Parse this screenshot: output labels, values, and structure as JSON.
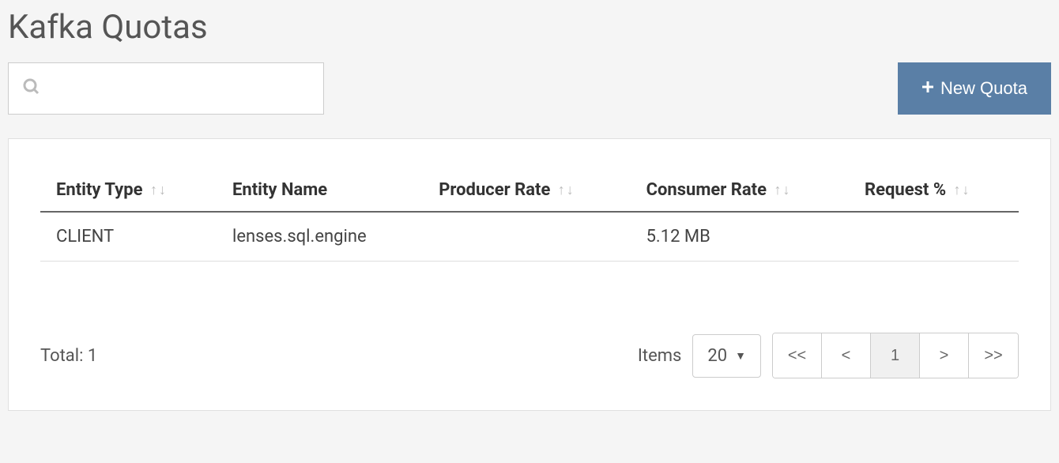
{
  "page": {
    "title": "Kafka Quotas"
  },
  "toolbar": {
    "search_placeholder": "",
    "new_quota_label": "New Quota"
  },
  "table": {
    "columns": {
      "entity_type": "Entity Type",
      "entity_name": "Entity Name",
      "producer_rate": "Producer Rate",
      "consumer_rate": "Consumer Rate",
      "request_pct": "Request %"
    },
    "rows": [
      {
        "entity_type": "CLIENT",
        "entity_name": "lenses.sql.engine",
        "producer_rate": "",
        "consumer_rate": "5.12 MB",
        "request_pct": ""
      }
    ],
    "total_label": "Total: 1"
  },
  "pagination": {
    "items_label": "Items",
    "page_size": "20",
    "first": "<<",
    "prev": "<",
    "current": "1",
    "next": ">",
    "last": ">>"
  }
}
